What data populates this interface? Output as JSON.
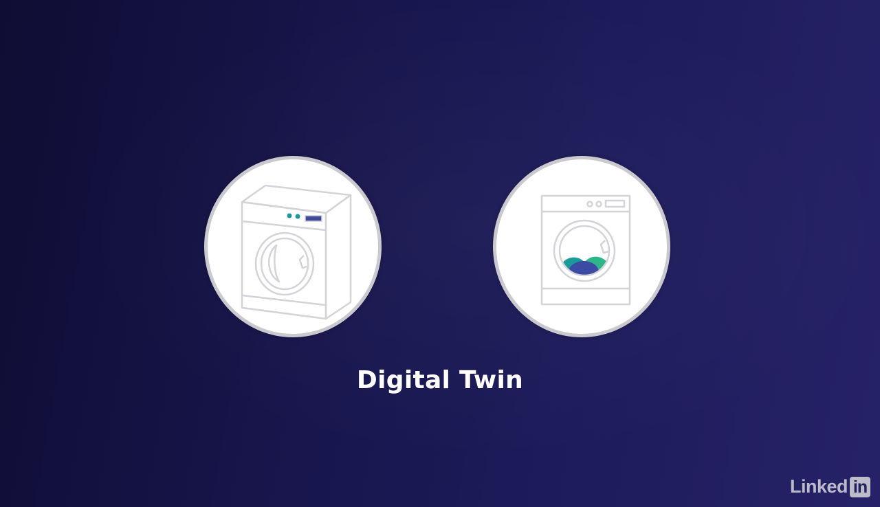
{
  "caption": "Digital Twin",
  "logo": {
    "text": "Linked",
    "box_text": "in"
  },
  "icons": {
    "left": "washing-machine-3d-icon",
    "right": "washing-machine-front-icon"
  },
  "colors": {
    "outline": "#d3d3d8",
    "teal": "#1c9a9a",
    "green": "#2fb58c",
    "indigo": "#3c4aa3",
    "display": "#3f4a9a"
  }
}
